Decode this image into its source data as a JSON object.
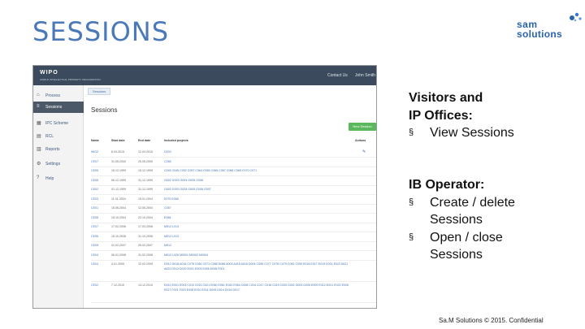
{
  "slide": {
    "title": "SESSIONS",
    "logo": {
      "line1": "sam",
      "line2": "solutions"
    },
    "footer": "Sa.M Solutions © 2015. Confidential"
  },
  "app": {
    "logo": "WIPO",
    "org": "WORLD INTELLECTUAL PROPERTY ORGANIZATION",
    "top_links": [
      "Contact Us",
      "John Smith"
    ],
    "sidebar": [
      {
        "icon": "home-icon",
        "label": "Process"
      },
      {
        "icon": "list-icon",
        "label": "Sessions",
        "active": true
      },
      {
        "icon": "grid-icon",
        "label": "IPC Scheme"
      },
      {
        "icon": "doc-icon",
        "label": "RCL"
      },
      {
        "icon": "report-icon",
        "label": "Reports"
      },
      {
        "icon": "gear-icon",
        "label": "Settings"
      },
      {
        "icon": "help-icon",
        "label": "Help"
      }
    ],
    "breadcrumb": "Sessions",
    "title": "Sessions",
    "new_button": "New Session",
    "table": {
      "columns": [
        "Name",
        "Start date",
        "End date",
        "Included projects",
        "Actions"
      ],
      "rows": [
        [
          "WIO2",
          "8.04.2015",
          "12.04.2015",
          "D203"
        ],
        [
          "CE07",
          "31.05.2000",
          "25.05.2000",
          "C265"
        ],
        [
          "CE05",
          "15.12.1999",
          "15.12.1999",
          "C045 C046 C052 C057 C064 C065 C066 C067 C068 C069 C070 C071"
        ],
        [
          "CE06",
          "06.12.1999",
          "31.12.1999",
          "G002 G003 G004 G005 G006"
        ],
        [
          "CE02",
          "01.12.1999",
          "31.12.1999",
          "G002 G003 G004 G005 G006 G007"
        ],
        [
          "CE03",
          "11.01.2004",
          "15.01.2004",
          "E070 E065"
        ],
        [
          "CE01",
          "15.06.2004",
          "12.06.2004",
          "C057"
        ],
        [
          "CE08",
          "15.10.2004",
          "22.10.2004",
          "E068"
        ],
        [
          "CE07",
          "17.02.2006",
          "17.03.2006",
          "M512 L013"
        ],
        [
          "CE06",
          "15.10.2006",
          "31.10.2006",
          "M512 L013"
        ],
        [
          "CE05",
          "01.02.2007",
          "25.02.2007",
          "M512"
        ],
        [
          "CE04",
          "06.01.2008",
          "31.02.2008",
          "M512 L026 M0001 M0002 M0004"
        ]
      ],
      "long_rows": [
        [
          "CE04",
          "4.01.2009",
          "12.02.2009",
          "D012 D018 A018 C076 C081 C071 C086 D066 A003 A015 A018 D004 C055 C077 C078 C079 C081 C090 E016 E017 E019 E021 E022 A021 A022 D013 D020 E001 E003 E006 E008 F001"
        ],
        [
          "CE02",
          "7.12.2010",
          "14.12.2010",
          "D010 E001 E003 C010 C015 C021 E060 E061 E062 E064 C008 C016 C017 C018 C019 C020 D001 D003 D005 E009 E012 E021 E022 E026 E027 F001 F003 E008 E010 E011 D009 D014 D016 D017"
        ]
      ]
    }
  },
  "panel": {
    "visitors_head_1": "Visitors and",
    "visitors_head_2": "IP Offices:",
    "visitors_items": [
      "View Sessions"
    ],
    "operator_head": "IB Operator:",
    "operator_items": [
      "Create / delete Sessions",
      "Open / close Sessions"
    ],
    "bullet_mark": "§"
  }
}
